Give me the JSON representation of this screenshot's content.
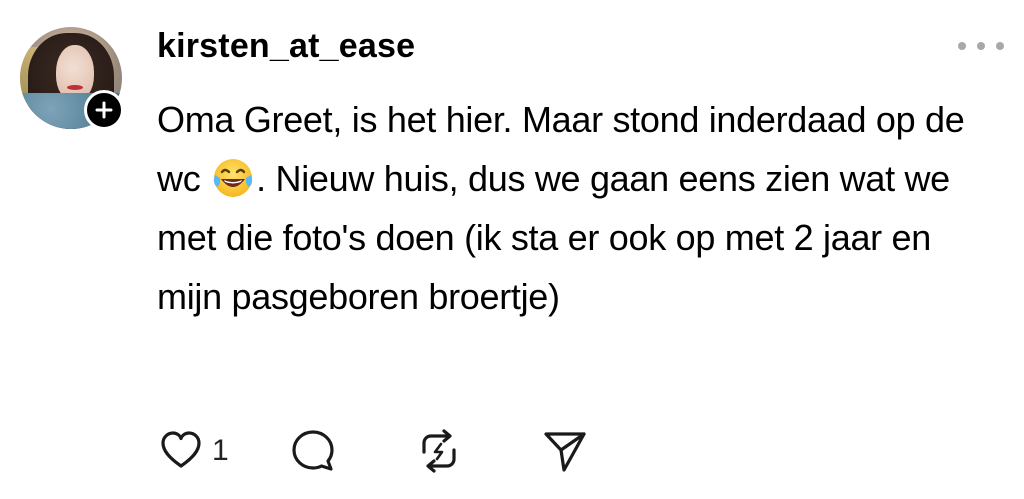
{
  "post": {
    "username": "kirsten_at_ease",
    "text_before_emoji": "Oma Greet, is het hier. Maar stond inderdaad op de wc ",
    "emoji": "😂",
    "text_after_emoji": ". Nieuw huis, dus we gaan eens zien wat we met die foto's doen (ik sta er ook op met 2 jaar en mijn pasgeboren broertje)",
    "like_count": "1"
  },
  "icons": {
    "follow": "plus-icon",
    "more": "more-icon",
    "like": "heart-icon",
    "reply": "comment-icon",
    "repost": "repost-icon",
    "share": "send-icon"
  },
  "colors": {
    "text": "#000000",
    "muted": "#a8a8a8",
    "icon": "#1a1a1a"
  }
}
